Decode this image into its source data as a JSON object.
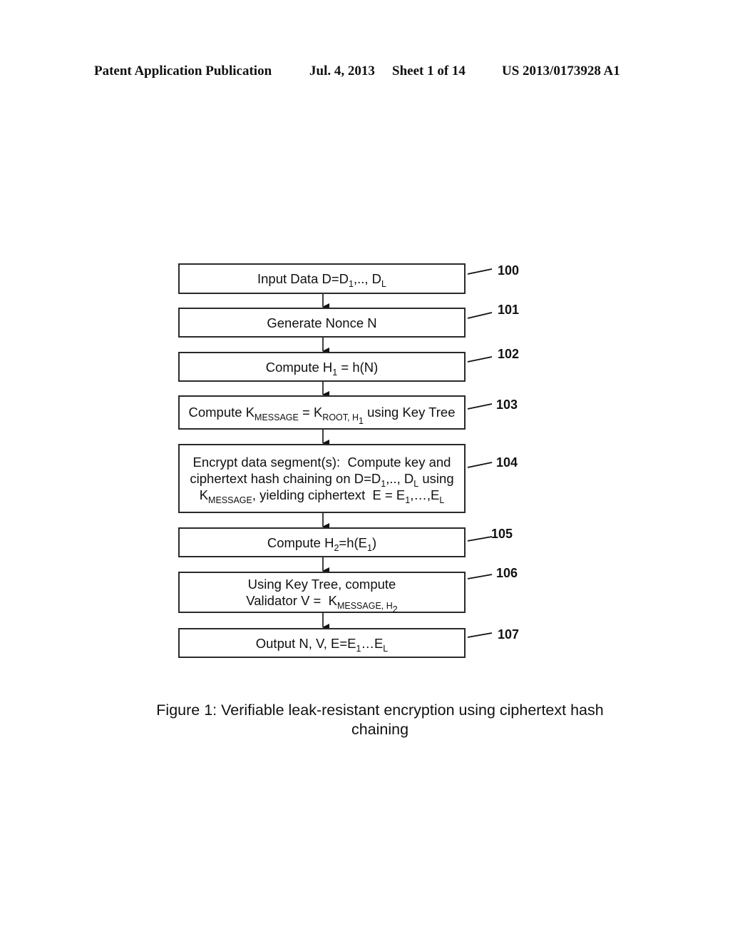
{
  "header": {
    "publication_type": "Patent Application Publication",
    "date": "Jul. 4, 2013",
    "sheet": "Sheet 1 of 14",
    "publication_number": "US 2013/0173928 A1"
  },
  "flowchart": {
    "steps": [
      {
        "ref": "100",
        "html_text": "Input Data D=D<sub>1</sub>,.., D<sub>L</sub>"
      },
      {
        "ref": "101",
        "html_text": "Generate Nonce N"
      },
      {
        "ref": "102",
        "html_text": "Compute H<sub>1</sub> = h(N)"
      },
      {
        "ref": "103",
        "html_text": "Compute K<sub>MESSAGE</sub> = K<sub>ROOT, H<sub>1</sub></sub> using Key Tree"
      },
      {
        "ref": "104",
        "html_text": "Encrypt data segment(s):&nbsp; Compute key and<br>ciphertext hash chaining on D=D<sub>1</sub>,.., D<sub>L</sub> using<br>K<sub>MESSAGE</sub>, yielding ciphertext&nbsp; E = E<sub>1</sub>,…,E<sub>L</sub>"
      },
      {
        "ref": "105",
        "html_text": "Compute H<sub>2</sub>=h(E<sub>1</sub>)"
      },
      {
        "ref": "106",
        "html_text": "Using Key Tree, compute<br>Validator V = &nbsp;K<sub>MESSAGE, H<sub>2</sub></sub>"
      },
      {
        "ref": "107",
        "html_text": "Output N, V, E=E<sub>1</sub>…E<sub>L</sub>"
      }
    ]
  },
  "caption": "Figure 1: Verifiable leak-resistant encryption using ciphertext hash chaining"
}
